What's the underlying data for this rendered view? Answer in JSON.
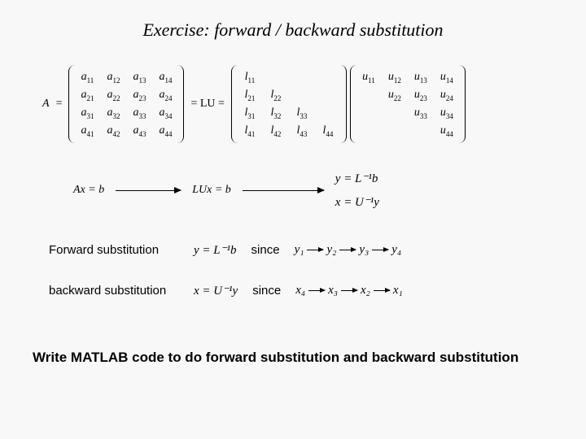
{
  "title": "Exercise: forward / backward  substitution",
  "lu": {
    "A_eq": "A",
    "eq1": "=",
    "LU_eq": "= LU =",
    "A": [
      [
        "a",
        "11"
      ],
      [
        "a",
        "12"
      ],
      [
        "a",
        "13"
      ],
      [
        "a",
        "14"
      ],
      [
        "a",
        "21"
      ],
      [
        "a",
        "22"
      ],
      [
        "a",
        "23"
      ],
      [
        "a",
        "24"
      ],
      [
        "a",
        "31"
      ],
      [
        "a",
        "32"
      ],
      [
        "a",
        "33"
      ],
      [
        "a",
        "34"
      ],
      [
        "a",
        "41"
      ],
      [
        "a",
        "42"
      ],
      [
        "a",
        "43"
      ],
      [
        "a",
        "44"
      ]
    ],
    "L": [
      [
        "l",
        "11"
      ],
      [
        "",
        ""
      ],
      [
        "",
        ""
      ],
      [
        "",
        ""
      ],
      [
        "l",
        "21"
      ],
      [
        "l",
        "22"
      ],
      [
        "",
        ""
      ],
      [
        "",
        ""
      ],
      [
        "l",
        "31"
      ],
      [
        "l",
        "32"
      ],
      [
        "l",
        "33"
      ],
      [
        "",
        ""
      ],
      [
        "l",
        "41"
      ],
      [
        "l",
        "42"
      ],
      [
        "l",
        "43"
      ],
      [
        "l",
        "44"
      ]
    ],
    "U": [
      [
        "u",
        "11"
      ],
      [
        "u",
        "12"
      ],
      [
        "u",
        "13"
      ],
      [
        "u",
        "14"
      ],
      [
        "",
        ""
      ],
      [
        "u",
        "22"
      ],
      [
        "u",
        "23"
      ],
      [
        "u",
        "24"
      ],
      [
        "",
        ""
      ],
      [
        "",
        ""
      ],
      [
        "u",
        "33"
      ],
      [
        "u",
        "34"
      ],
      [
        "",
        ""
      ],
      [
        "",
        ""
      ],
      [
        "",
        ""
      ],
      [
        "u",
        "44"
      ]
    ]
  },
  "solve": {
    "eq1": "Ax = b",
    "eq2": "LUx = b",
    "eq3a": "y = L⁻¹b",
    "eq3b": "x = U⁻¹y"
  },
  "forward": {
    "label": "Forward substitution",
    "expr": "y = L⁻¹b",
    "since": "since",
    "chain_items": [
      "y₁",
      "y₂",
      "y₃",
      "y₄"
    ]
  },
  "backward": {
    "label": "backward substitution",
    "expr": "x = U⁻¹y",
    "since": "since",
    "chain_items": [
      "x₄",
      "x₃",
      "x₂",
      "x₁"
    ]
  },
  "task": "Write MATLAB code to do forward substitution and backward substitution"
}
